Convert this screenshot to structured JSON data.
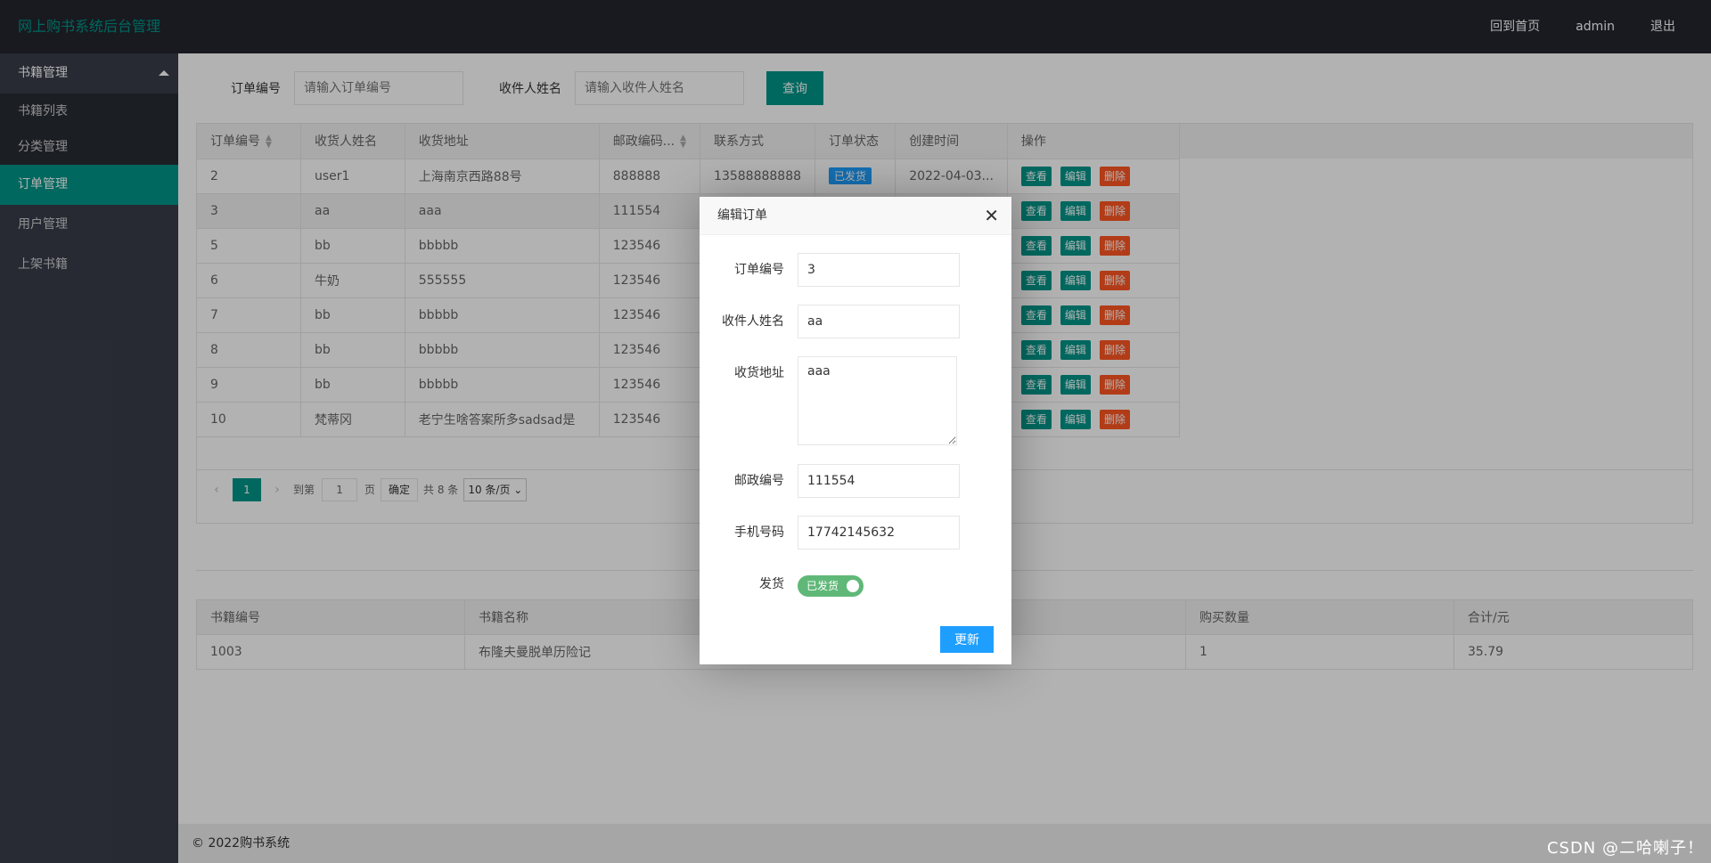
{
  "header": {
    "logo": "网上购书系统后台管理",
    "nav": [
      "回到首页",
      "admin",
      "退出"
    ]
  },
  "sidebar": {
    "group": "书籍管理",
    "sub_items": [
      "书籍列表",
      "分类管理"
    ],
    "items": [
      "订单管理",
      "用户管理",
      "上架书籍"
    ],
    "active": "订单管理"
  },
  "search": {
    "order_label": "订单编号",
    "order_placeholder": "请输入订单编号",
    "name_label": "收件人姓名",
    "name_placeholder": "请输入收件人姓名",
    "button": "查询"
  },
  "orders": {
    "columns": [
      "订单编号",
      "收货人姓名",
      "收货地址",
      "邮政编码...",
      "联系方式",
      "订单状态",
      "创建时间",
      "操作"
    ],
    "rows": [
      {
        "id": "2",
        "name": "user1",
        "address": "上海南京西路88号",
        "zip": "888888",
        "phone": "13588888888",
        "status": "已发货",
        "created": "2022-04-03..."
      },
      {
        "id": "3",
        "name": "aa",
        "address": "aaa",
        "zip": "111554",
        "phone": "",
        "status": "",
        "created": ""
      },
      {
        "id": "5",
        "name": "bb",
        "address": "bbbbb",
        "zip": "123546",
        "phone": "",
        "status": "",
        "created": ""
      },
      {
        "id": "6",
        "name": "牛奶",
        "address": "555555",
        "zip": "123546",
        "phone": "",
        "status": "",
        "created": ""
      },
      {
        "id": "7",
        "name": "bb",
        "address": "bbbbb",
        "zip": "123546",
        "phone": "",
        "status": "",
        "created": ""
      },
      {
        "id": "8",
        "name": "bb",
        "address": "bbbbb",
        "zip": "123546",
        "phone": "",
        "status": "",
        "created": ""
      },
      {
        "id": "9",
        "name": "bb",
        "address": "bbbbb",
        "zip": "123546",
        "phone": "",
        "status": "",
        "created": ""
      },
      {
        "id": "10",
        "name": "梵蒂冈",
        "address": "老宁生啥答案所多sadsad是",
        "zip": "123546",
        "phone": "",
        "status": "",
        "created": ""
      }
    ],
    "actions": {
      "view": "查看",
      "edit": "编辑",
      "delete": "删除"
    }
  },
  "pager": {
    "current": "1",
    "goto_label": "到第",
    "goto_value": "1",
    "page_label": "页",
    "confirm": "确定",
    "total": "共 8 条",
    "size": "10 条/页"
  },
  "detail": {
    "columns": [
      "书籍编号",
      "书籍名称",
      "购买数量",
      "合计/元"
    ],
    "rows": [
      {
        "book_id": "1003",
        "book_name": "布隆夫曼脱单历险记",
        "qty": "1",
        "total": "35.79"
      }
    ]
  },
  "modal": {
    "title": "编辑订单",
    "order_label": "订单编号",
    "order_value": "3",
    "name_label": "收件人姓名",
    "name_value": "aa",
    "address_label": "收货地址",
    "address_value": "aaa",
    "zip_label": "邮政编号",
    "zip_value": "111554",
    "phone_label": "手机号码",
    "phone_value": "17742145632",
    "ship_label": "发货",
    "ship_switch": "已发货",
    "update_button": "更新"
  },
  "footer": "© 2022购书系统",
  "watermark": "CSDN @二哈喇子！"
}
